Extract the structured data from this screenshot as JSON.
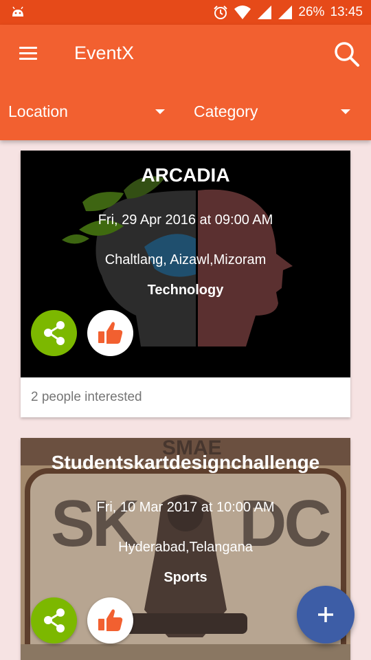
{
  "status_bar": {
    "battery": "26%",
    "time": "13:45",
    "icons": [
      "android-icon",
      "alarm-icon",
      "wifi-icon",
      "signal-icon",
      "signal-icon",
      "battery-icon"
    ]
  },
  "app_bar": {
    "title": "EventX",
    "menu_icon": "menu-icon",
    "search_icon": "search-icon",
    "color": "#f26030"
  },
  "filters": {
    "location": "Location",
    "category": "Category"
  },
  "events": [
    {
      "title": "ARCADIA",
      "date": "Fri, 29 Apr 2016 at 09:00 AM",
      "location": "Chaltlang, Aizawl,Mizoram",
      "category": "Technology",
      "interested": "2 people interested"
    },
    {
      "title": "Studentskartdesignchallenge",
      "date": "Fri, 10 Mar 2017 at 10:00 AM",
      "location": "Hyderabad,Telangana",
      "category": "Sports",
      "background_text": [
        "SMAE",
        "SK",
        "DC"
      ]
    }
  ],
  "fab": {
    "icon": "plus-icon",
    "color": "#3d5da6"
  },
  "accent": {
    "share": "#7cb800",
    "like": "#f26030"
  }
}
